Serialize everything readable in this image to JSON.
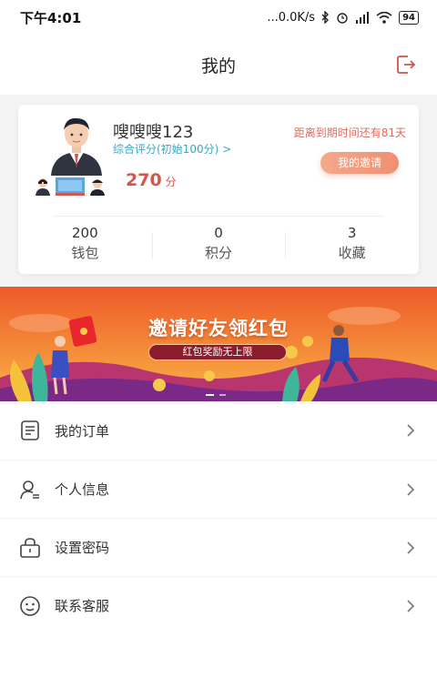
{
  "status_bar": {
    "time": "下午4:01",
    "network_speed": "...0.0K/s",
    "battery": "94"
  },
  "header": {
    "title": "我的"
  },
  "profile": {
    "username": "嗖嗖嗖123",
    "rating_link": "综合评分(初始100分) >",
    "score": "270",
    "score_unit": "分",
    "expiry_text": "距离到期时间还有81天",
    "invite_button": "我的邀请"
  },
  "stats": [
    {
      "value": "200",
      "label": "钱包"
    },
    {
      "value": "0",
      "label": "积分"
    },
    {
      "value": "3",
      "label": "收藏"
    }
  ],
  "banner": {
    "title": "邀请好友领红包",
    "tag": "红包奖励无上限"
  },
  "menu": [
    {
      "label": "我的订单",
      "icon": "order-list-icon"
    },
    {
      "label": "个人信息",
      "icon": "person-icon"
    },
    {
      "label": "设置密码",
      "icon": "lock-icon"
    },
    {
      "label": "联系客服",
      "icon": "customer-service-icon"
    }
  ],
  "colors": {
    "accent_red": "#d2564b",
    "link_blue": "#3aa6c6",
    "invite_orange": "#ef8f71"
  }
}
